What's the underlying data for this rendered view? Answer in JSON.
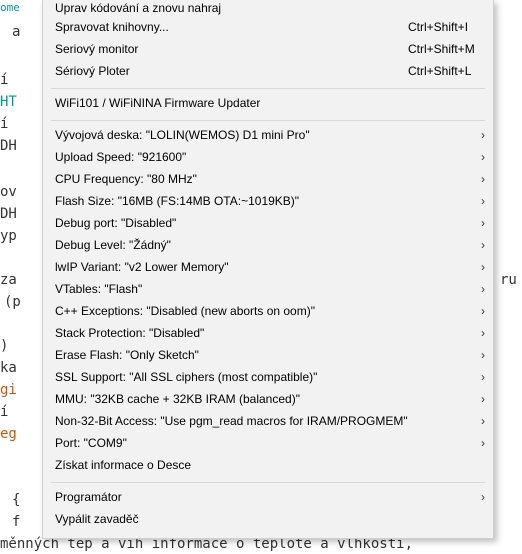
{
  "background": {
    "tab_fragment": "ome",
    "code_lines": [
      {
        "text": "a",
        "color": "default"
      },
      {
        "text": "í",
        "color": "default"
      },
      {
        "text": "HT",
        "color": "blue"
      },
      {
        "text": "í",
        "color": "default"
      },
      {
        "text": "DH",
        "color": "default"
      },
      {
        "text": "ov",
        "color": "default"
      },
      {
        "text": "DH",
        "color": "default"
      },
      {
        "text": "yp",
        "color": "default"
      },
      {
        "text": "za",
        "color": "default"
      },
      {
        "text": "ru",
        "color": "default"
      },
      {
        "text": "(p",
        "color": "default"
      },
      {
        "text": ")",
        "color": "default"
      },
      {
        "text": "ka",
        "color": "default"
      },
      {
        "text": "gi",
        "color": "orange"
      },
      {
        "text": "í",
        "color": "default"
      },
      {
        "text": "eg",
        "color": "orange"
      },
      {
        "text": "{",
        "color": "default"
      },
      {
        "text": "f",
        "color": "default"
      },
      {
        "text": "měnných tep a vih informace o teplotě a vlhkosti,",
        "color": "default"
      }
    ]
  },
  "menu": {
    "items": [
      {
        "label": "Uprav kódování a znovu nahraj",
        "shortcut": "",
        "submenu": false
      },
      {
        "label": "Spravovat knihovny...",
        "shortcut": "Ctrl+Shift+I",
        "submenu": false
      },
      {
        "label": "Seriový monitor",
        "shortcut": "Ctrl+Shift+M",
        "submenu": false
      },
      {
        "label": "Sériový Ploter",
        "shortcut": "Ctrl+Shift+L",
        "submenu": false
      },
      {
        "label": "WiFi101 / WiFiNINA Firmware Updater",
        "shortcut": "",
        "submenu": false
      },
      {
        "label": "Vývojová deska: \"LOLIN(WEMOS) D1 mini Pro\"",
        "shortcut": "",
        "submenu": true
      },
      {
        "label": "Upload Speed: \"921600\"",
        "shortcut": "",
        "submenu": true
      },
      {
        "label": "CPU Frequency: \"80 MHz\"",
        "shortcut": "",
        "submenu": true
      },
      {
        "label": "Flash Size: \"16MB (FS:14MB OTA:~1019KB)\"",
        "shortcut": "",
        "submenu": true
      },
      {
        "label": "Debug port: \"Disabled\"",
        "shortcut": "",
        "submenu": true
      },
      {
        "label": "Debug Level: \"Žádný\"",
        "shortcut": "",
        "submenu": true
      },
      {
        "label": "lwIP Variant: \"v2 Lower Memory\"",
        "shortcut": "",
        "submenu": true
      },
      {
        "label": "VTables: \"Flash\"",
        "shortcut": "",
        "submenu": true
      },
      {
        "label": "C++ Exceptions: \"Disabled (new aborts on oom)\"",
        "shortcut": "",
        "submenu": true
      },
      {
        "label": "Stack Protection: \"Disabled\"",
        "shortcut": "",
        "submenu": true
      },
      {
        "label": "Erase Flash: \"Only Sketch\"",
        "shortcut": "",
        "submenu": true
      },
      {
        "label": "SSL Support: \"All SSL ciphers (most compatible)\"",
        "shortcut": "",
        "submenu": true
      },
      {
        "label": "MMU: \"32KB cache + 32KB IRAM (balanced)\"",
        "shortcut": "",
        "submenu": true
      },
      {
        "label": "Non-32-Bit Access: \"Use pgm_read macros for IRAM/PROGMEM\"",
        "shortcut": "",
        "submenu": true
      },
      {
        "label": "Port: \"COM9\"",
        "shortcut": "",
        "submenu": true
      },
      {
        "label": "Získat informace o Desce",
        "shortcut": "",
        "submenu": false
      },
      {
        "label": "Programátor",
        "shortcut": "",
        "submenu": true
      },
      {
        "label": "Vypálit zavaděč",
        "shortcut": "",
        "submenu": false
      }
    ],
    "submenu_arrow": "›"
  }
}
